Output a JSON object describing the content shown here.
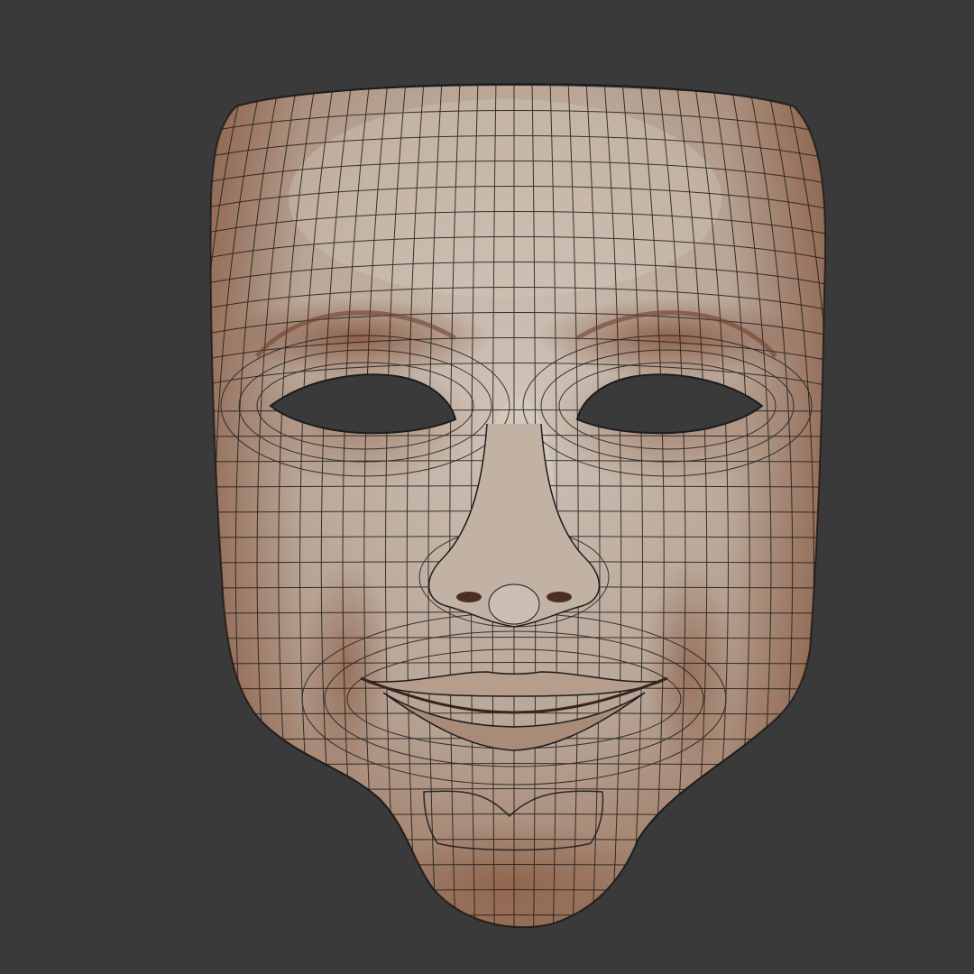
{
  "scene": {
    "background_color": "#3a3a3a",
    "object": "wireframe-face-mask",
    "mask_base_color": "#b8a596",
    "mask_highlight_color": "#cfc2b6",
    "mask_shadow_color": "#8e5f45",
    "wire_color": "#1c1c1c",
    "eye_hole_color": "#3a3a3a"
  }
}
